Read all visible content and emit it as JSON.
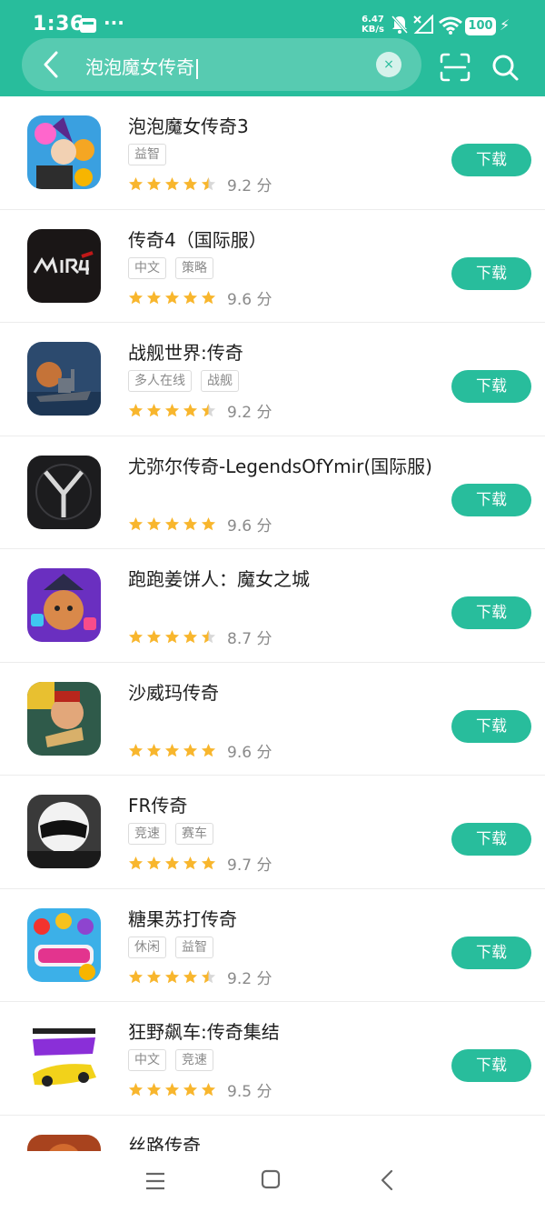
{
  "status": {
    "time": "1:36",
    "more": "···",
    "net_speed_value": "6.47",
    "net_speed_unit": "KB/s",
    "battery": "100"
  },
  "search": {
    "query": "泡泡魔女传奇",
    "clear": "×"
  },
  "colors": {
    "accent": "#28bd9c",
    "star": "#f8b62d",
    "star_empty": "#d8d8d8"
  },
  "apps": [
    {
      "name": "泡泡魔女传奇3",
      "tags": [
        "益智"
      ],
      "stars": 4.5,
      "score": "9.2 分",
      "download": "下载"
    },
    {
      "name": "传奇4（国际服）",
      "tags": [
        "中文",
        "策略"
      ],
      "stars": 5,
      "score": "9.6 分",
      "download": "下载"
    },
    {
      "name": "战舰世界:传奇",
      "tags": [
        "多人在线",
        "战舰"
      ],
      "stars": 4.5,
      "score": "9.2 分",
      "download": "下载"
    },
    {
      "name": "尤弥尔传奇-LegendsOfYmir(国际服)",
      "tags": [],
      "stars": 5,
      "score": "9.6 分",
      "download": "下载"
    },
    {
      "name": "跑跑姜饼人：魔女之城",
      "tags": [],
      "stars": 4.5,
      "score": "8.7 分",
      "download": "下载"
    },
    {
      "name": "沙威玛传奇",
      "tags": [],
      "stars": 5,
      "score": "9.6 分",
      "download": "下载"
    },
    {
      "name": "FR传奇",
      "tags": [
        "竞速",
        "赛车"
      ],
      "stars": 5,
      "score": "9.7 分",
      "download": "下载"
    },
    {
      "name": "糖果苏打传奇",
      "tags": [
        "休闲",
        "益智"
      ],
      "stars": 4.5,
      "score": "9.2 分",
      "download": "下载"
    },
    {
      "name": "狂野飙车:传奇集结",
      "tags": [
        "中文",
        "竞速"
      ],
      "stars": 5,
      "score": "9.5 分",
      "download": "下载"
    },
    {
      "name": "丝路传奇",
      "tags": [],
      "stars": 0,
      "score": "",
      "download": ""
    }
  ],
  "icons": {
    "back": "chevron-left-icon",
    "scan": "scan-icon",
    "search": "search-icon",
    "nav": [
      "menu-icon",
      "home-icon",
      "back-icon"
    ]
  }
}
